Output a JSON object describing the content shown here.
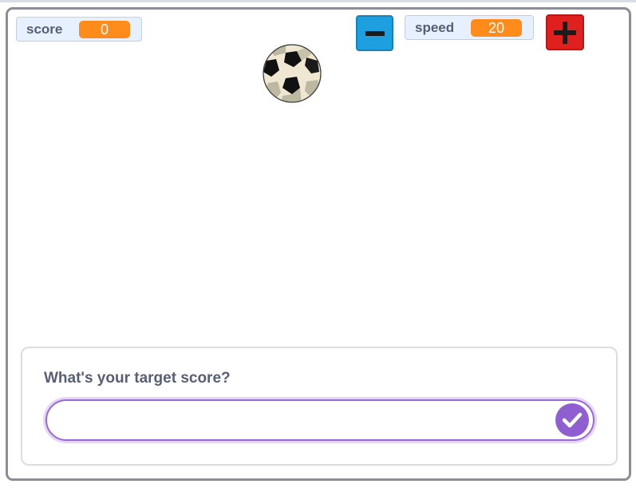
{
  "variables": {
    "score": {
      "label": "score",
      "value": "0"
    },
    "speed": {
      "label": "speed",
      "value": "20"
    }
  },
  "controls": {
    "minus_icon": "minus-icon",
    "plus_icon": "plus-icon"
  },
  "sprite": {
    "icon": "soccer-ball-icon"
  },
  "ask": {
    "question": "What's your target score?",
    "answer_value": "",
    "submit_icon": "checkmark-icon"
  },
  "colors": {
    "monitor_value": "#ff8c1a",
    "minus_button": "#1ea0e0",
    "plus_button": "#e0201f",
    "submit_button": "#8f5fd1",
    "stage_border": "#8a8e97"
  }
}
